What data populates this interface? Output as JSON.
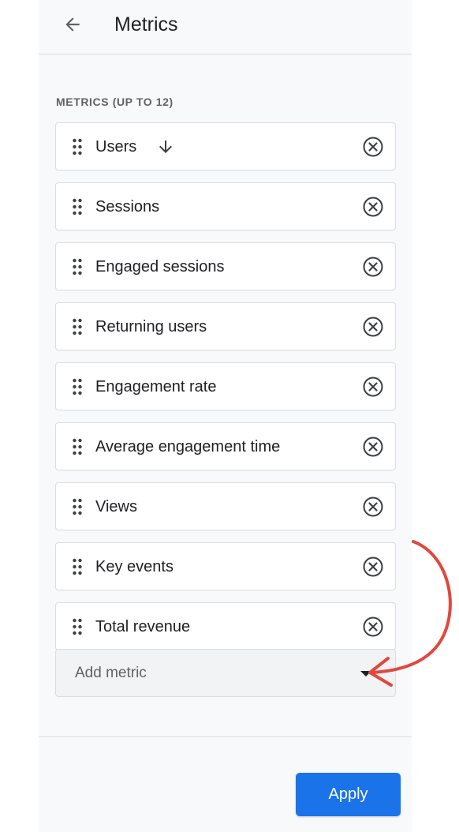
{
  "header": {
    "title": "Metrics",
    "back_icon": "arrow-left-icon"
  },
  "section": {
    "label": "METRICS (UP TO 12)"
  },
  "metrics": [
    {
      "label": "Users",
      "sorted": true
    },
    {
      "label": "Sessions"
    },
    {
      "label": "Engaged sessions"
    },
    {
      "label": "Returning users"
    },
    {
      "label": "Engagement rate"
    },
    {
      "label": "Average engagement time"
    },
    {
      "label": "Views"
    },
    {
      "label": "Key events"
    },
    {
      "label": "Total revenue"
    }
  ],
  "add_metric": {
    "placeholder": "Add metric"
  },
  "footer": {
    "apply_label": "Apply"
  },
  "colors": {
    "accent": "#1a73e8",
    "annotation": "#e0483e",
    "panel_bg": "#f8f9fa"
  }
}
